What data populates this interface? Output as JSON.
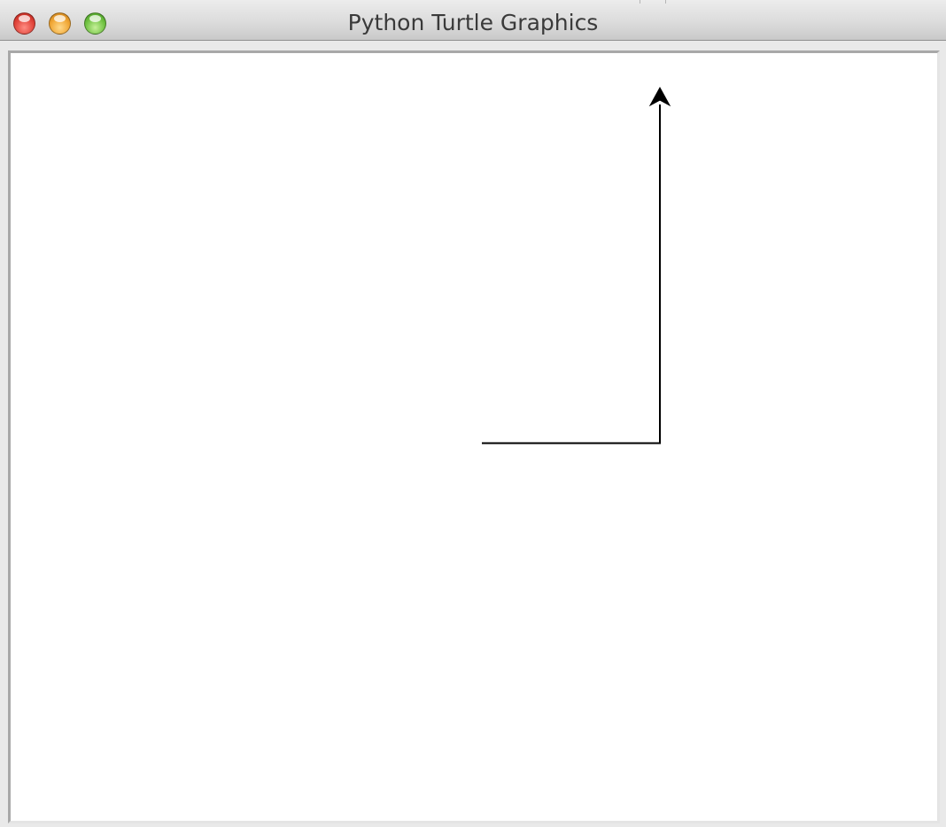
{
  "window": {
    "title": "Python Turtle Graphics"
  },
  "colors": {
    "canvas_background": "#ffffff",
    "pen": "#000000",
    "close_button": "#e0443a",
    "minimize_button": "#f0a634",
    "zoom_button": "#70c242"
  },
  "icons": {
    "close": "close-traffic-light-icon",
    "minimize": "minimize-traffic-light-icon",
    "zoom": "zoom-traffic-light-icon",
    "turtle": "turtle-arrow-cursor-icon"
  }
}
